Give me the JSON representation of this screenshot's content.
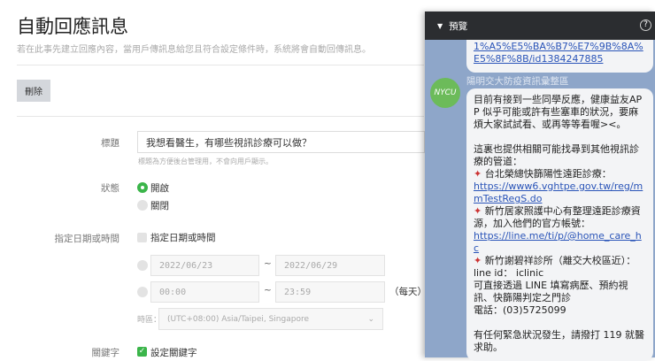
{
  "page": {
    "title": "自動回應訊息",
    "subtitle": "若在此事先建立回應內容，當用戶傳訊息給您且符合設定條件時，系統將會自動回傳訊息。",
    "delete_label": "刪除"
  },
  "form": {
    "title_label": "標題",
    "title_value": "我想看醫生，有哪些視訊診療可以做？",
    "title_hint": "標題為方便後台管理用，不會向用戶顯示。",
    "status_label": "狀態",
    "status_on": "開啟",
    "status_off": "關閉",
    "date_label": "指定日期或時間",
    "date_checkbox": "指定日期或時間",
    "date_from": "2022/06/23",
    "date_to": "2022/06/29",
    "tilde": "~",
    "time_from": "00:00",
    "time_to": "23:59",
    "daily": "（每天）",
    "tz_label": "時區：",
    "tz_value": "(UTC+08:00) Asia/Taipei, Singapore",
    "keyword_label": "關鍵字",
    "keyword_checkbox": "設定關鍵字"
  },
  "preview": {
    "header": "預覽",
    "help_icon": "?",
    "prev_link": "1%A5%E5%BA%B7%E7%9B%8A%E5%8F%8B/id1384247885",
    "sender": "陽明交大防疫資訊彙整區",
    "avatar_text": "NYCU",
    "msg": {
      "p1": "目前有接到一些同學反應，健康益友APP 似乎可能或許有些塞車的狀況，要麻煩大家試試看、或再等等看喔><。",
      "p2": "這裏也提供相關可能找尋到其他視訊診療的管道：",
      "i1": "台北榮總快篩陽性遠距診療：",
      "l1": "https://www6.vghtpe.gov.tw/reg/mmTestRegS.do",
      "i2": "新竹居家照護中心有整理遠距診療資源，加入他們的官方帳號：",
      "l2": "https://line.me/ti/p/@home_care_hc",
      "i3": "新竹謝碧祥診所（離交大校區近）：",
      "t1": "line id： iclinic",
      "t2": "可直接透過 LINE 填寫病歷、預約視訊、快篩陽判定之門診",
      "t3": "電話：(03)5725099",
      "p3": "有任何緊急狀況發生，請撥打 119 就醫求助。"
    }
  }
}
